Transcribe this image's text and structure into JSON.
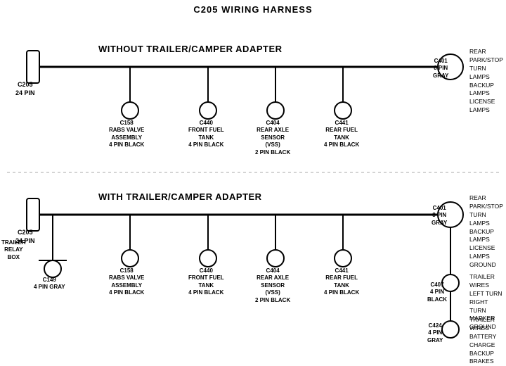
{
  "title": "C205 WIRING HARNESS",
  "section1": {
    "label": "WITHOUT TRAILER/CAMPER ADAPTER",
    "connectors": [
      {
        "id": "C205_top",
        "label": "C205\n24 PIN",
        "type": "rect"
      },
      {
        "id": "C158_top",
        "label": "C158\nRABS VALVE\nASSEMBLY\n4 PIN BLACK"
      },
      {
        "id": "C440_top",
        "label": "C440\nFRONT FUEL\nTANK\n4 PIN BLACK"
      },
      {
        "id": "C404_top",
        "label": "C404\nREAR AXLE\nSENSOR\n(VSS)\n2 PIN BLACK"
      },
      {
        "id": "C441_top",
        "label": "C441\nREAR FUEL\nTANK\n4 PIN BLACK"
      },
      {
        "id": "C401_top",
        "label": "C401\n8 PIN\nGRAY",
        "type": "large",
        "side_label": "REAR PARK/STOP\nTURN LAMPS\nBACKUP LAMPS\nLICENSE LAMPS"
      }
    ]
  },
  "section2": {
    "label": "WITH TRAILER/CAMPER ADAPTER",
    "connectors": [
      {
        "id": "C205_bot",
        "label": "C205\n24 PIN",
        "type": "rect"
      },
      {
        "id": "C158_bot",
        "label": "C158\nRABS VALVE\nASSEMBLY\n4 PIN BLACK"
      },
      {
        "id": "C440_bot",
        "label": "C440\nFRONT FUEL\nTANK\n4 PIN BLACK"
      },
      {
        "id": "C404_bot",
        "label": "C404\nREAR AXLE\nSENSOR\n(VSS)\n2 PIN BLACK"
      },
      {
        "id": "C441_bot",
        "label": "C441\nREAR FUEL\nTANK\n4 PIN BLACK"
      },
      {
        "id": "C401_bot",
        "label": "C401\n8 PIN\nGRAY",
        "type": "large",
        "side_label": "REAR PARK/STOP\nTURN LAMPS\nBACKUP LAMPS\nLICENSE LAMPS\nGROUND"
      },
      {
        "id": "C149",
        "label": "C149\n4 PIN GRAY"
      },
      {
        "id": "C407",
        "label": "C407\n4 PIN\nBLACK",
        "side_label": "TRAILER WIRES\nLEFT TURN\nRIGHT TURN\nMARKER\nGROUND"
      },
      {
        "id": "C424",
        "label": "C424\n4 PIN\nGRAY",
        "side_label": "TRAILER WIRES\nBATTERY CHARGE\nBACKUP\nBRAKES"
      }
    ]
  }
}
